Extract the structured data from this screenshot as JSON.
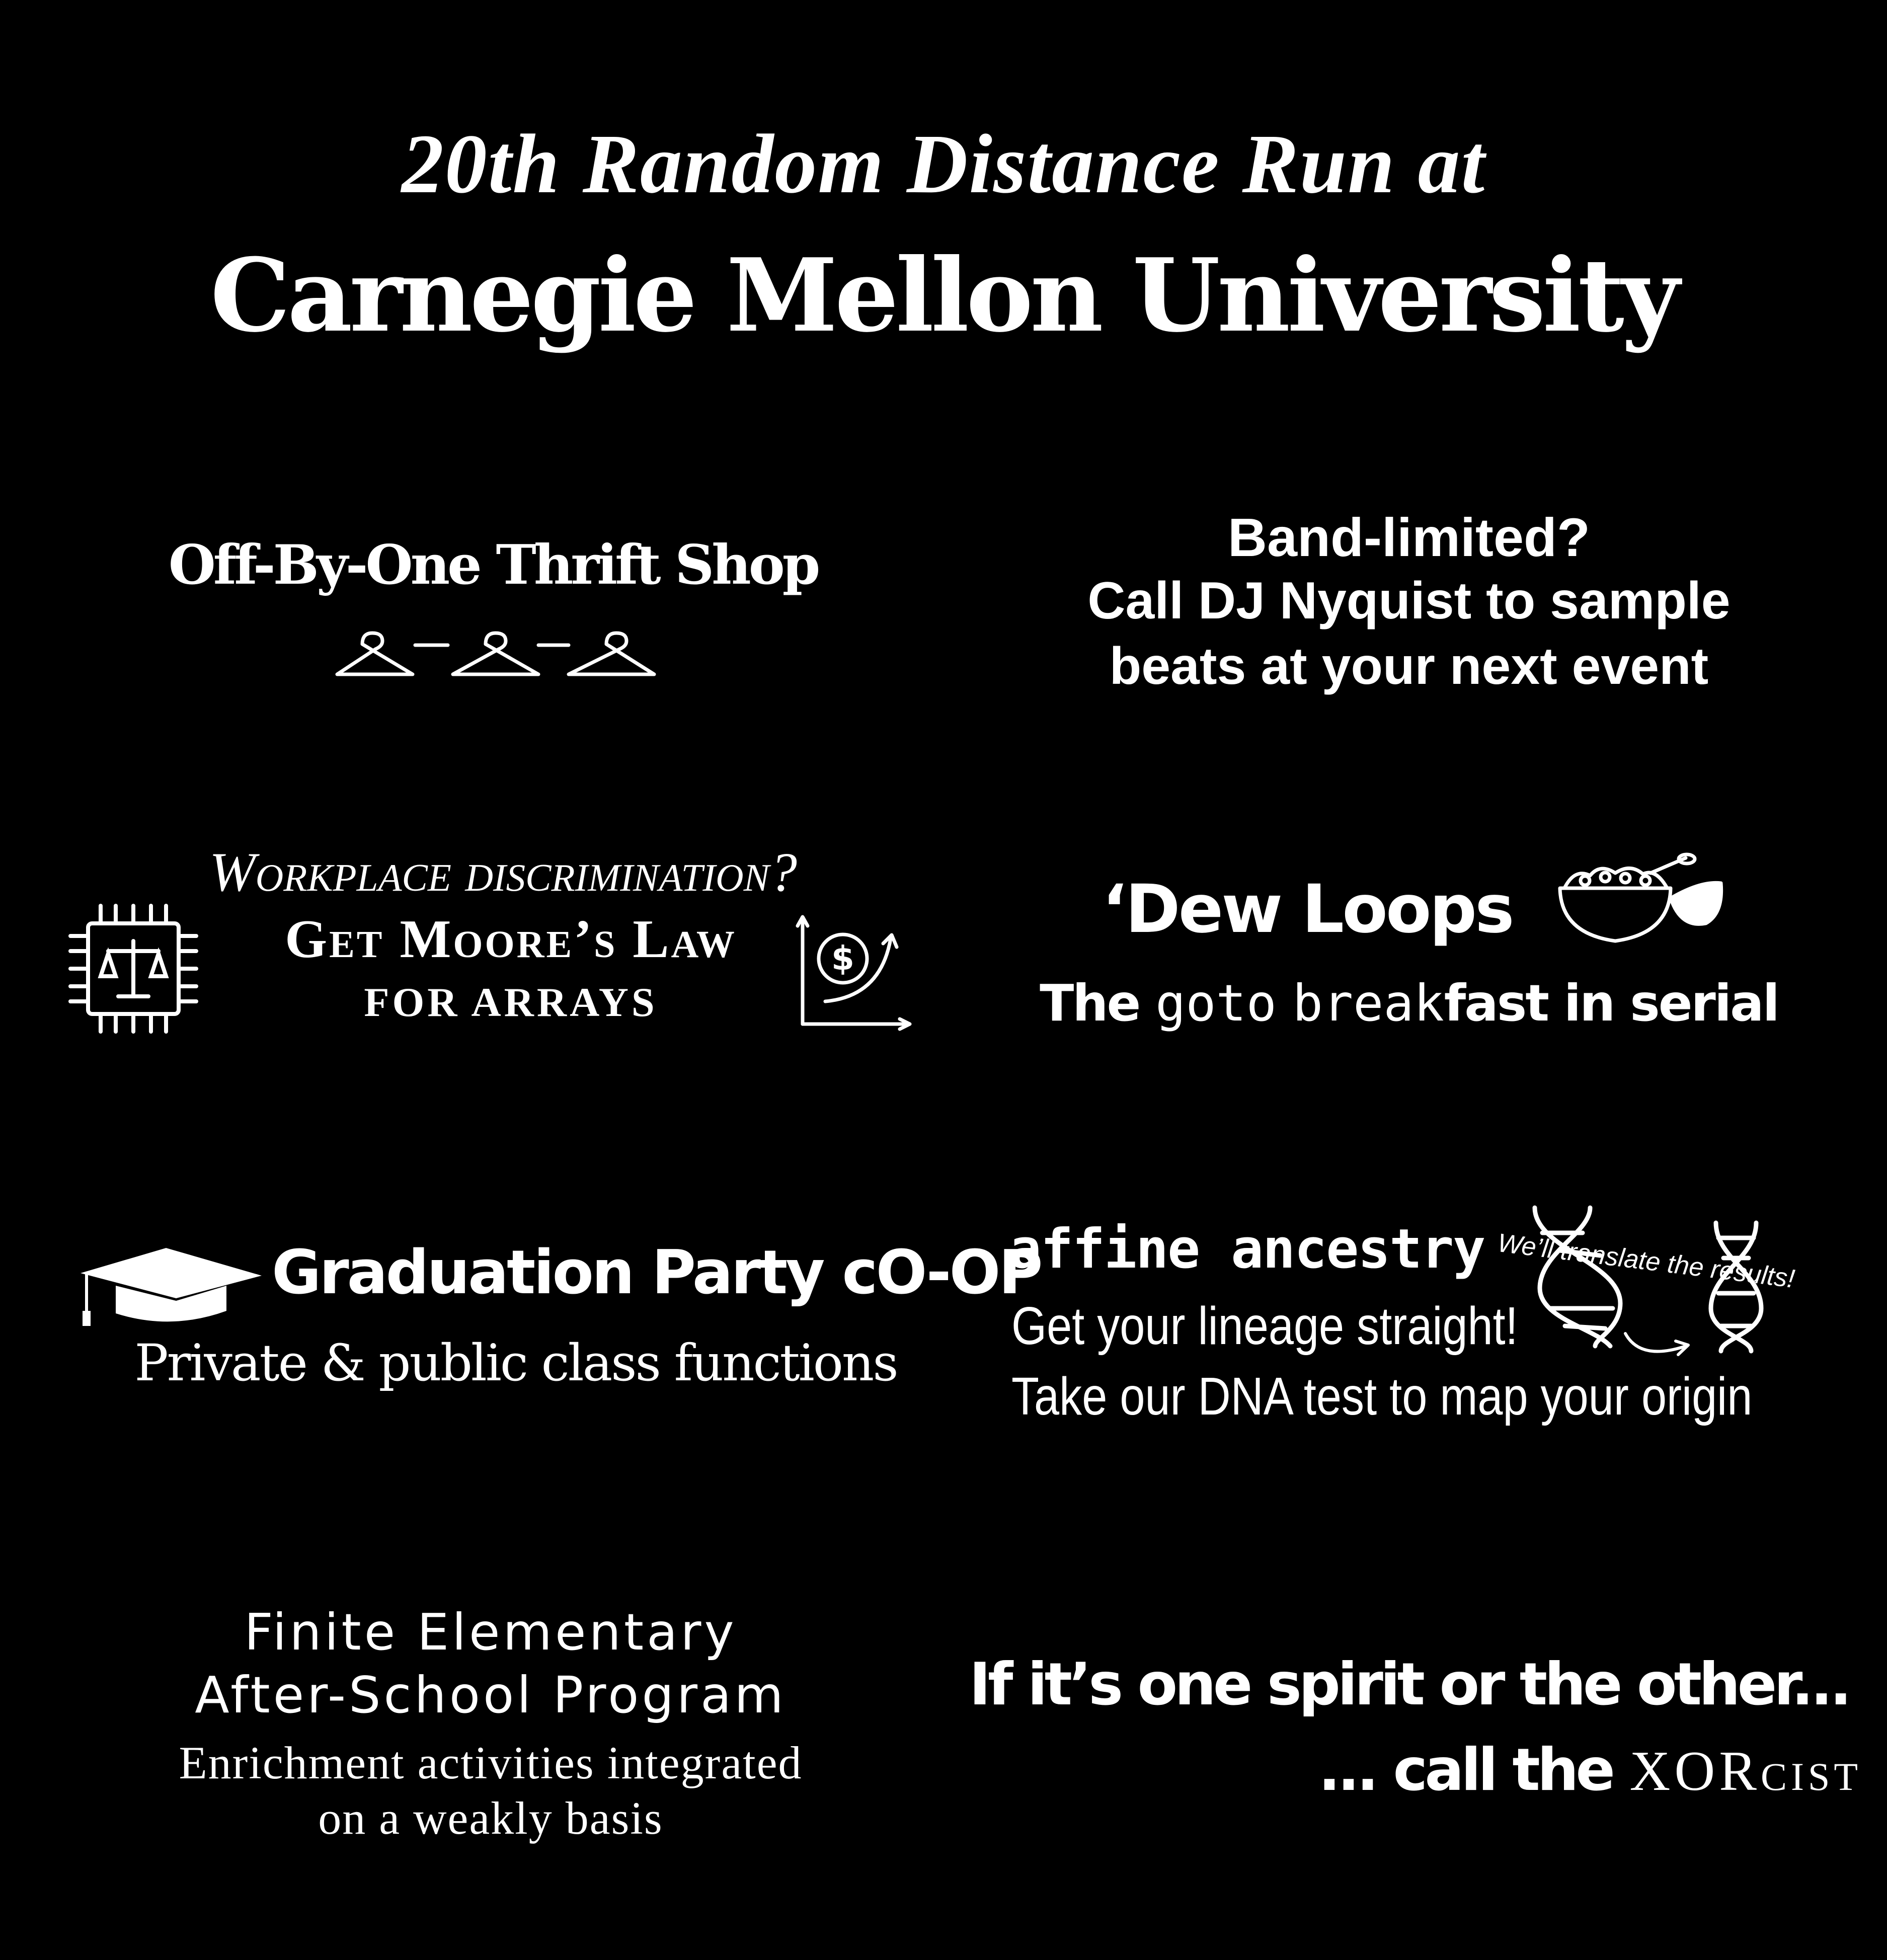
{
  "header": {
    "line1": "20th Random Distance Run at",
    "line2": "Carnegie Mellon University"
  },
  "ads": {
    "thrift": {
      "name": "Off-By-One Thrift Shop",
      "icon": "hanger-icon"
    },
    "band": {
      "line1": "Band-limited?",
      "line2": "Call DJ Nyquist to sample",
      "line3": "beats at your next event"
    },
    "workplace": {
      "line1": "Workplace discrimination?",
      "line2": "Get Moore’s Law",
      "line3": "FOR ARRAYS",
      "icons": [
        "chip-scales-icon",
        "dollar-growth-chart-icon"
      ]
    },
    "dew": {
      "brand": "‘Dew Loops",
      "tag_the": "The",
      "tag_goto": "goto",
      "tag_break": "break",
      "tag_rest": "fast in serial",
      "icon": "cereal-bowl-icon"
    },
    "graduation": {
      "name": "Graduation Party cO-OP",
      "sub": "Private & public class functions",
      "icon": "graduation-cap-icon"
    },
    "affine": {
      "brand": "affine ancestry",
      "line1": "Get your lineage straight!",
      "line2": "Take our DNA test to map your origin",
      "translate": "We’ll translate the results!",
      "icons": [
        "dna-icon",
        "dna-icon"
      ]
    },
    "finite": {
      "line1": "Finite Elementary",
      "line2": "After-School Program",
      "line3": "Enrichment activities integrated",
      "line4": "on a weakly basis"
    },
    "xorcist": {
      "line1": "If it’s one spirit or the other...",
      "line2_pre": "... call the",
      "line2_brand": "XORcist"
    }
  }
}
